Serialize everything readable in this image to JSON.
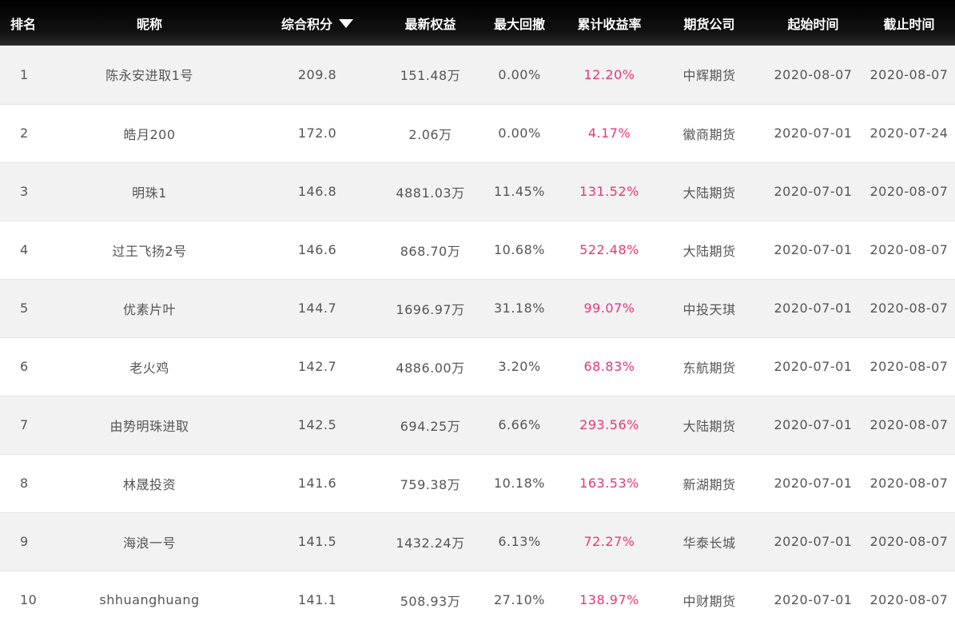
{
  "colors": {
    "header_bg": "#000000",
    "header_text": "#ffffff",
    "row_alt_bg": "#f2f2f2",
    "body_text": "#555555",
    "return_text": "#e8357a"
  },
  "icons": {
    "sort": "caret-down-icon"
  },
  "headers": {
    "rank": "排名",
    "nickname": "昵称",
    "score": "综合积分",
    "equity": "最新权益",
    "drawdown": "最大回撤",
    "return": "累计收益率",
    "broker": "期货公司",
    "start": "起始时间",
    "end": "截止时间"
  },
  "rows": [
    {
      "rank": "1",
      "nickname": "陈永安进取1号",
      "score": "209.8",
      "equity": "151.48万",
      "drawdown": "0.00%",
      "return": "12.20%",
      "broker": "中辉期货",
      "start": "2020-08-07",
      "end": "2020-08-07"
    },
    {
      "rank": "2",
      "nickname": "皓月200",
      "score": "172.0",
      "equity": "2.06万",
      "drawdown": "0.00%",
      "return": "4.17%",
      "broker": "徽商期货",
      "start": "2020-07-01",
      "end": "2020-07-24"
    },
    {
      "rank": "3",
      "nickname": "明珠1",
      "score": "146.8",
      "equity": "4881.03万",
      "drawdown": "11.45%",
      "return": "131.52%",
      "broker": "大陆期货",
      "start": "2020-07-01",
      "end": "2020-08-07"
    },
    {
      "rank": "4",
      "nickname": "过王飞扬2号",
      "score": "146.6",
      "equity": "868.70万",
      "drawdown": "10.68%",
      "return": "522.48%",
      "broker": "大陆期货",
      "start": "2020-07-01",
      "end": "2020-08-07"
    },
    {
      "rank": "5",
      "nickname": "优素片叶",
      "score": "144.7",
      "equity": "1696.97万",
      "drawdown": "31.18%",
      "return": "99.07%",
      "broker": "中投天琪",
      "start": "2020-07-01",
      "end": "2020-08-07"
    },
    {
      "rank": "6",
      "nickname": "老火鸡",
      "score": "142.7",
      "equity": "4886.00万",
      "drawdown": "3.20%",
      "return": "68.83%",
      "broker": "东航期货",
      "start": "2020-07-01",
      "end": "2020-08-07"
    },
    {
      "rank": "7",
      "nickname": "由势明珠进取",
      "score": "142.5",
      "equity": "694.25万",
      "drawdown": "6.66%",
      "return": "293.56%",
      "broker": "大陆期货",
      "start": "2020-07-01",
      "end": "2020-08-07"
    },
    {
      "rank": "8",
      "nickname": "林晟投资",
      "score": "141.6",
      "equity": "759.38万",
      "drawdown": "10.18%",
      "return": "163.53%",
      "broker": "新湖期货",
      "start": "2020-07-01",
      "end": "2020-08-07"
    },
    {
      "rank": "9",
      "nickname": "海浪一号",
      "score": "141.5",
      "equity": "1432.24万",
      "drawdown": "6.13%",
      "return": "72.27%",
      "broker": "华泰长城",
      "start": "2020-07-01",
      "end": "2020-08-07"
    },
    {
      "rank": "10",
      "nickname": "shhuanghuang",
      "score": "141.1",
      "equity": "508.93万",
      "drawdown": "27.10%",
      "return": "138.97%",
      "broker": "中财期货",
      "start": "2020-07-01",
      "end": "2020-08-07"
    }
  ]
}
